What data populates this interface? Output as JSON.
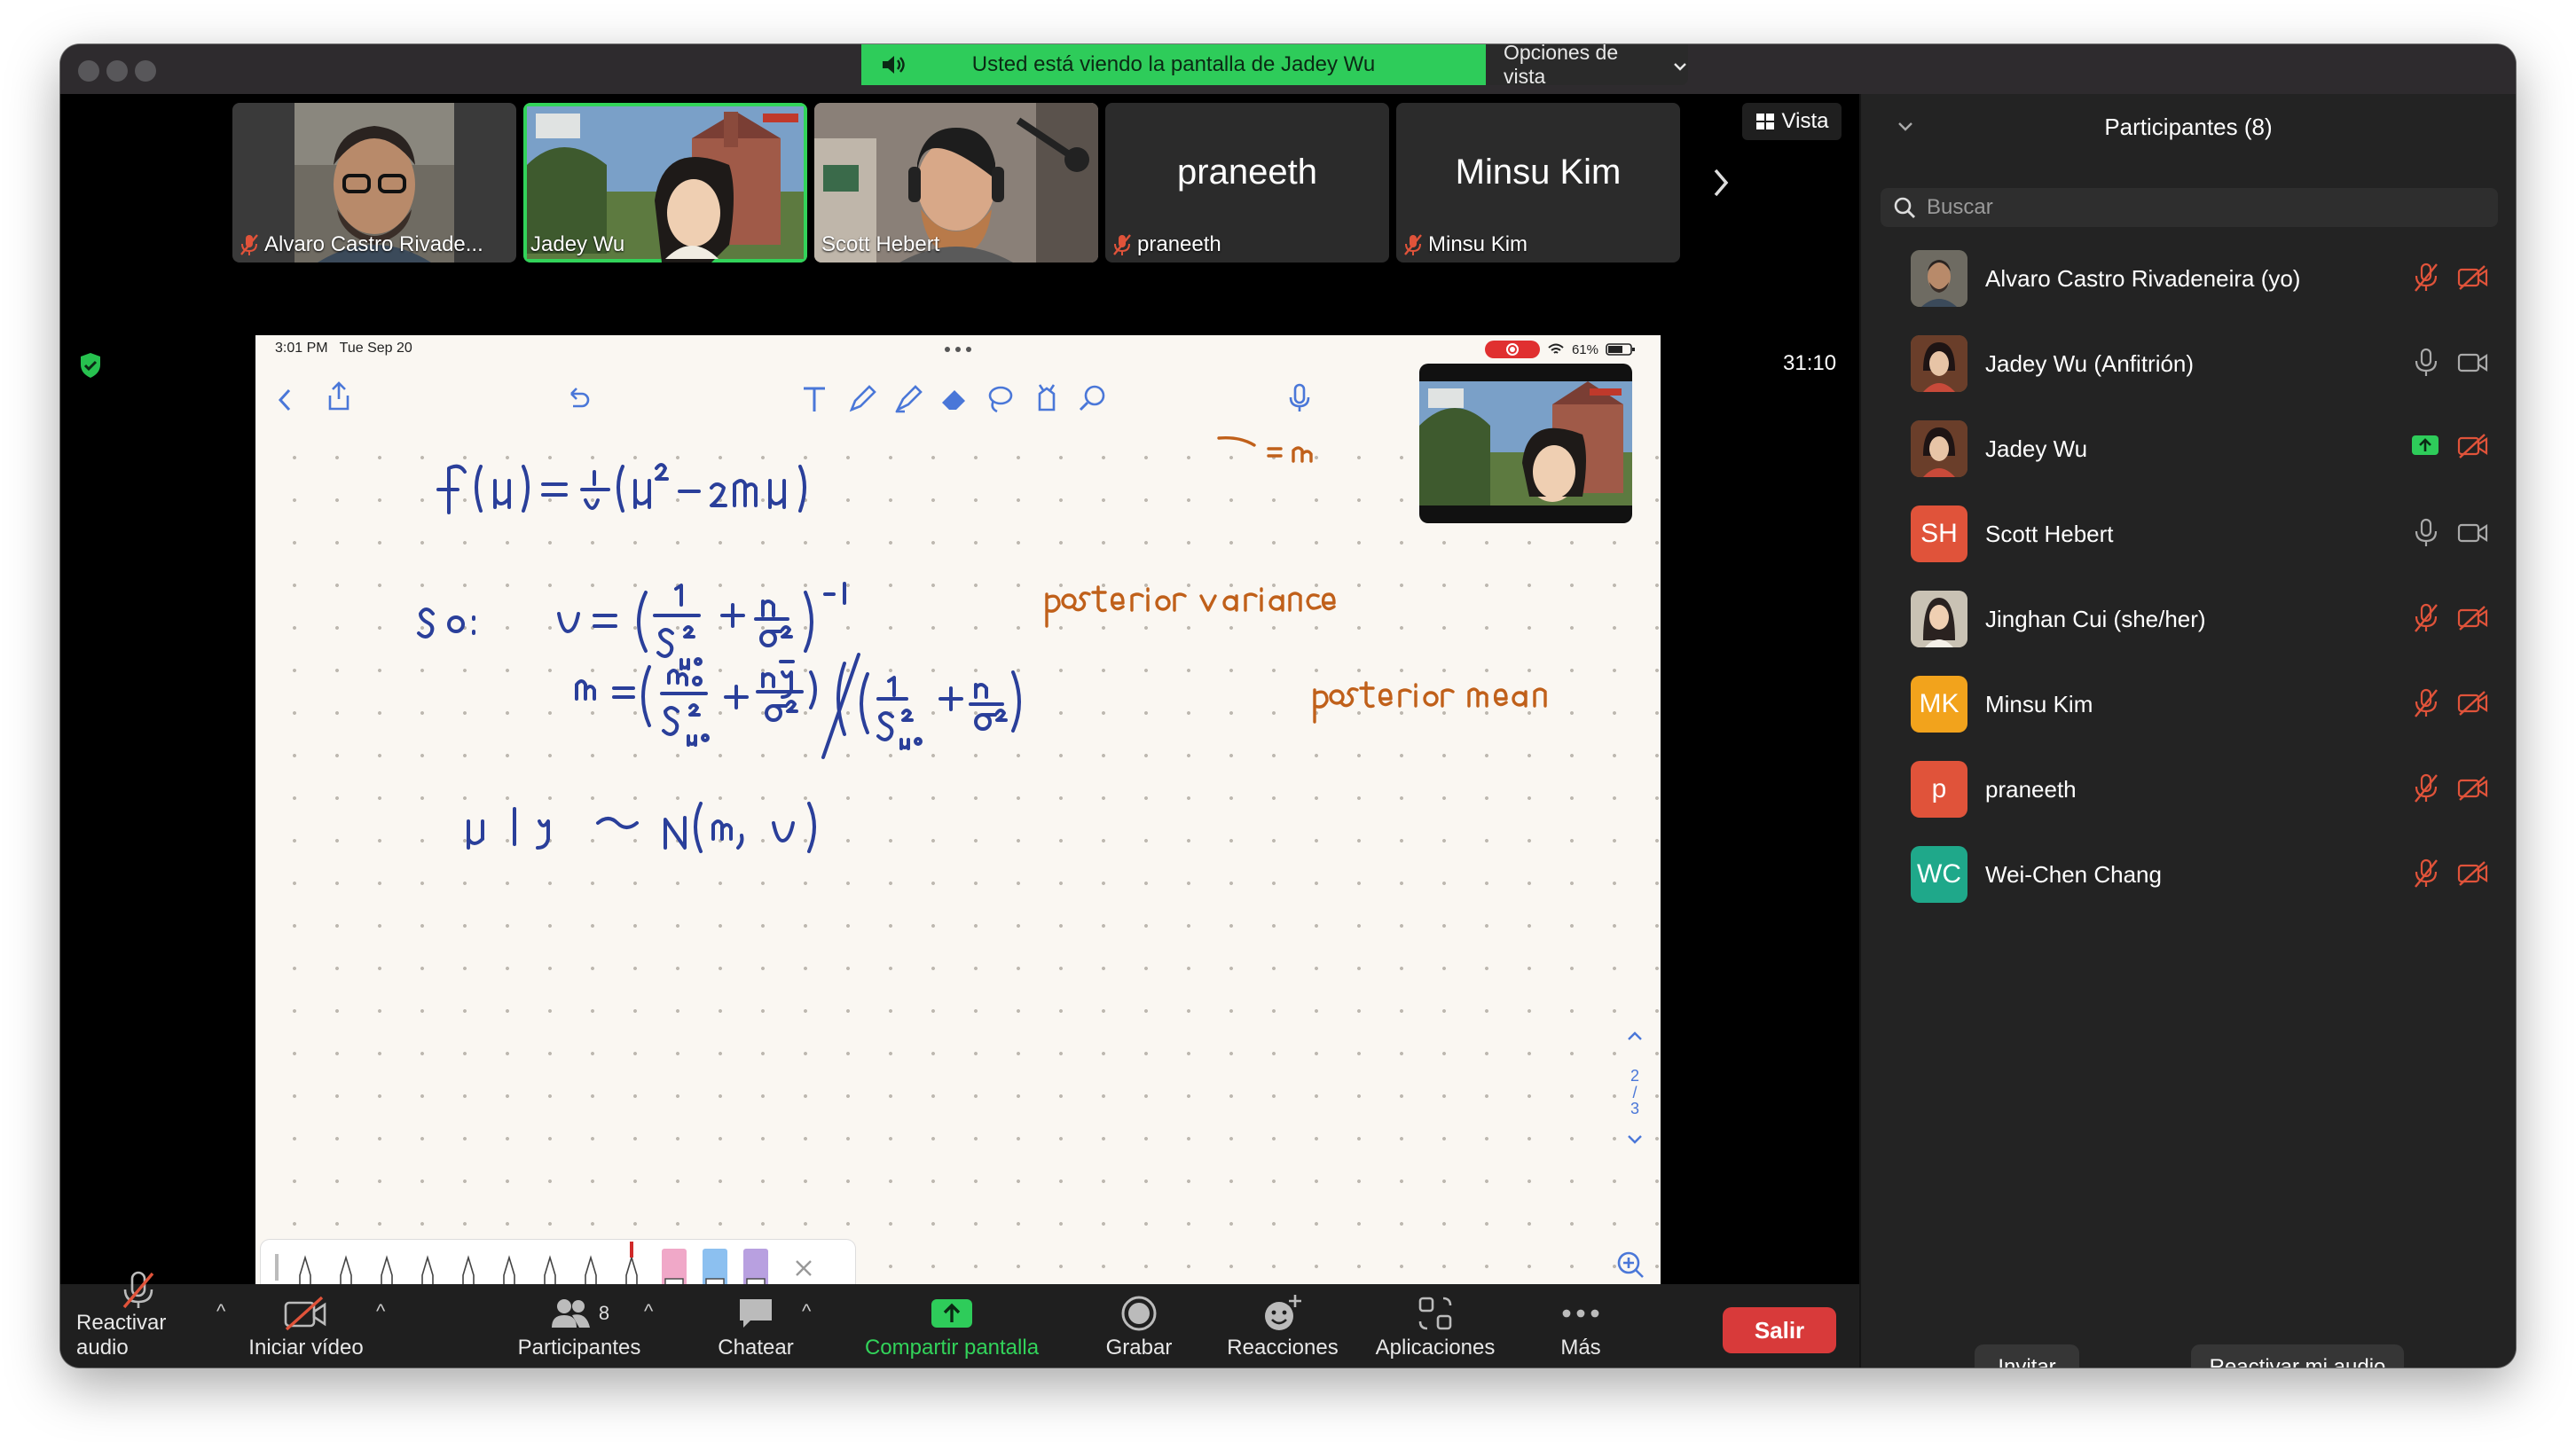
{
  "banner": {
    "text": "Usted está viendo la pantalla de Jadey Wu",
    "options_label": "Opciones de vista"
  },
  "vista_label": "Vista",
  "timer": "31:10",
  "tiles": [
    {
      "name": "Alvaro Castro Rivade...",
      "muted": true,
      "video": true
    },
    {
      "name": "Jadey Wu",
      "muted": false,
      "video": true,
      "active": true
    },
    {
      "name": "Scott Hebert",
      "muted": false,
      "video": true
    },
    {
      "name": "praneeth",
      "big_name": "praneeth",
      "muted": true,
      "video": false
    },
    {
      "name": "Minsu Kim",
      "big_name": "Minsu Kim",
      "muted": true,
      "video": false
    }
  ],
  "shared_screen": {
    "status_time": "3:01 PM",
    "status_date": "Tue Sep 20",
    "battery": "61%",
    "pager": [
      "2",
      "3"
    ]
  },
  "toolbar": {
    "unmute": "Reactivar audio",
    "start_video": "Iniciar vídeo",
    "participants": "Participantes",
    "participants_count": "8",
    "chat": "Chatear",
    "share": "Compartir pantalla",
    "record": "Grabar",
    "reactions": "Reacciones",
    "apps": "Aplicaciones",
    "more": "Más",
    "leave": "Salir"
  },
  "sidebar": {
    "title": "Participantes (8)",
    "search_placeholder": "Buscar",
    "participants": [
      {
        "name": "Alvaro Castro Rivadeneira (yo)",
        "initials": "",
        "color": "#5a6b4a",
        "mic": "muted",
        "cam": "off"
      },
      {
        "name": "Jadey Wu (Anfitrión)",
        "initials": "",
        "color": "#8a5a3a",
        "mic": "on",
        "cam": "on"
      },
      {
        "name": "Jadey Wu",
        "initials": "",
        "color": "#8a5a3a",
        "mic": "sharing",
        "cam": "off"
      },
      {
        "name": "Scott Hebert",
        "initials": "SH",
        "color": "#e0533a",
        "mic": "on",
        "cam": "on"
      },
      {
        "name": "Jinghan Cui (she/her)",
        "initials": "",
        "color": "#9a8f7a",
        "mic": "muted",
        "cam": "off"
      },
      {
        "name": "Minsu Kim",
        "initials": "MK",
        "color": "#f2a31c",
        "mic": "muted",
        "cam": "off"
      },
      {
        "name": "praneeth",
        "initials": "p",
        "color": "#e0533a",
        "mic": "muted",
        "cam": "off"
      },
      {
        "name": "Wei-Chen Chang",
        "initials": "WC",
        "color": "#1fa88a",
        "mic": "muted",
        "cam": "off"
      }
    ],
    "invite": "Invitar",
    "unmute_me": "Reactivar mi audio"
  },
  "colors": {
    "banner_green": "#2ecc5a",
    "active_border": "#32d35a",
    "leave_red": "#d83a3a",
    "muted_red": "#e0533a",
    "ink_blue": "#2a3f9a",
    "ink_orange": "#c0601a"
  }
}
